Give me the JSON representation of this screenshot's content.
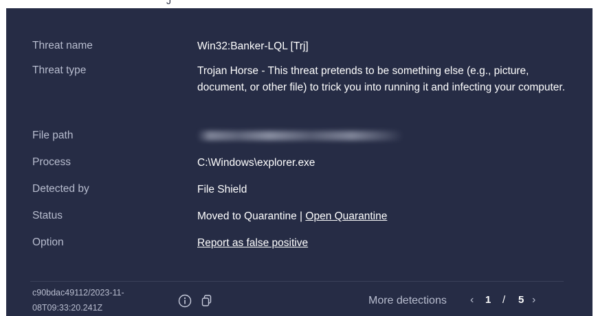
{
  "details": [
    {
      "label": "Threat name",
      "value": "Win32:Banker-LQL [Trj]"
    },
    {
      "label": "Threat type",
      "value": "Trojan Horse - This threat pretends to be something else (e.g., picture, document, or other file) to trick you into running it and infecting your computer."
    },
    {
      "label": "File path",
      "value": ""
    },
    {
      "label": "Process",
      "value": "C:\\Windows\\explorer.exe"
    },
    {
      "label": "Detected by",
      "value": "File Shield"
    },
    {
      "label": "Status",
      "value": "Moved to Quarantine | ",
      "link": "Open Quarantine"
    },
    {
      "label": "Option",
      "link": "Report as false positive"
    }
  ],
  "footer": {
    "detection_id_line1": "c90bdac49112/2023-11-",
    "detection_id_line2": "08T09:33:20.241Z",
    "info_icon": "info-circle-icon",
    "copy_icon": "copy-icon",
    "more_detections_label": "More detections",
    "pager": {
      "current": "1",
      "separator": "/",
      "total": "5",
      "prev": "‹",
      "next": "›"
    }
  },
  "colors": {
    "panel_bg": "#262c45",
    "label_text": "#b8bdcf",
    "value_text": "#ffffff"
  }
}
